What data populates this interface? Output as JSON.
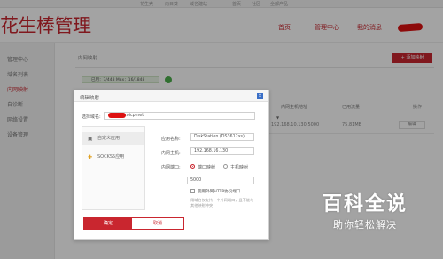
{
  "topbar": {
    "links": [
      "花生壳",
      "向日葵",
      "域名建站",
      "首页",
      "社区",
      "全部产品"
    ]
  },
  "header": {
    "logo": "花生棒管理",
    "nav": [
      "首页",
      "管理中心",
      "我的消息"
    ]
  },
  "sidebar": {
    "items": [
      {
        "label": "管理中心",
        "active": false
      },
      {
        "label": "域名列表",
        "active": false
      },
      {
        "label": "内网映射",
        "active": true
      },
      {
        "label": "自诊断",
        "active": false
      },
      {
        "label": "网络设置",
        "active": false
      },
      {
        "label": "设备管理",
        "active": false
      }
    ]
  },
  "main": {
    "title": "内网映射",
    "add_button": "+ 添加映射",
    "info_text": "已用：7/448    Max：16/1848",
    "columns": [
      "内网主机地址",
      "已用流量",
      "操作"
    ],
    "row": {
      "host": "192.168.10.130:5000",
      "traffic": "75.81MB",
      "action": "编辑"
    }
  },
  "dialog": {
    "title": "编辑映射",
    "close": "×",
    "domain_label": "选择域名:",
    "domain_value": "test.oicp.net",
    "tabs": [
      {
        "icon": "▣",
        "label": "自定义应用"
      },
      {
        "icon": "✚",
        "label": "SOCKS5应用"
      }
    ],
    "fields": {
      "app_name_label": "应用名称:",
      "app_name_value": "DiskStation (DS3612xs)",
      "host_label": "内网主机:",
      "host_value": "192.168.16.130",
      "port_label": "内网端口:",
      "port_option_1": "端口映射",
      "port_option_2": "主机映射",
      "port_value": "5000",
      "https_label": "使用外网HTTP协议端口",
      "hint": "用域名仅支持一个外网端口，且不能与其他映射冲突"
    },
    "ok_button": "确定",
    "cancel_button": "取消"
  },
  "watermark": {
    "title": "百科全说",
    "subtitle": "助你轻松解决"
  },
  "colors": {
    "brand": "#c9262f",
    "success": "#4cae4c",
    "close_blue": "#3a6fc7"
  }
}
